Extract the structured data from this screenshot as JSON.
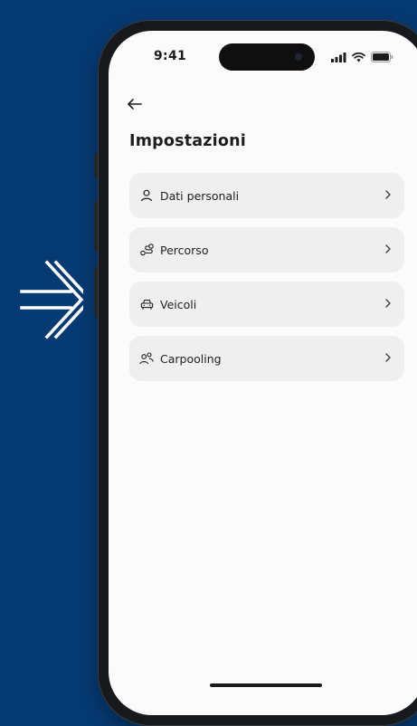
{
  "colors": {
    "background": "#063a73",
    "screen": "#fbfbfb",
    "item_bg": "#efefef",
    "text": "#1d1d1f"
  },
  "status_bar": {
    "time": "9:41",
    "icons": [
      "signal-icon",
      "wifi-icon",
      "battery-icon"
    ]
  },
  "header": {
    "back_icon": "arrow-left-icon",
    "title": "Impostazioni"
  },
  "settings": {
    "items": [
      {
        "label": "Dati personali",
        "icon": "person-icon"
      },
      {
        "label": "Percorso",
        "icon": "route-icon"
      },
      {
        "label": "Veicoli",
        "icon": "car-icon"
      },
      {
        "label": "Carpooling",
        "icon": "people-icon"
      }
    ]
  }
}
